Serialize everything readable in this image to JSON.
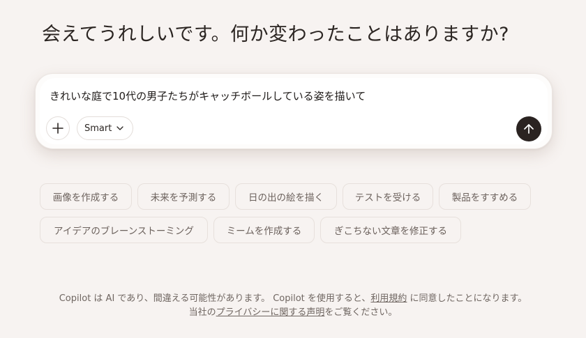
{
  "greeting": {
    "text": "会えてうれしいです。何か変わったことはありますか?"
  },
  "composer": {
    "prompt_text": "きれいな庭で10代の男子たちがキャッチボールしている姿を描いて",
    "mode_label": "Smart",
    "plus_icon": "plus-icon",
    "chevron_icon": "chevron-down-icon",
    "send_icon": "arrow-up-icon"
  },
  "suggestions": {
    "row1": [
      "画像を作成する",
      "未来を予測する",
      "日の出の絵を描く",
      "テストを受ける",
      "製品をすすめる"
    ],
    "row2": [
      "アイデアのブレーンストーミング",
      "ミームを作成する",
      "ぎこちない文章を修正する"
    ]
  },
  "footer": {
    "line1_part1": "Copilot は AI であり、間違える可能性があります。 Copilot を使用すると、",
    "terms_link": "利用規約",
    "line1_part2": " に同意したことになります。",
    "line2_part1": "当社の",
    "privacy_link": "プライバシーに関する声明",
    "line2_part2": "をご覧ください。"
  },
  "colors": {
    "background": "#f7f3f1",
    "send_button": "#2a2321",
    "chip_text": "#6c625d"
  }
}
